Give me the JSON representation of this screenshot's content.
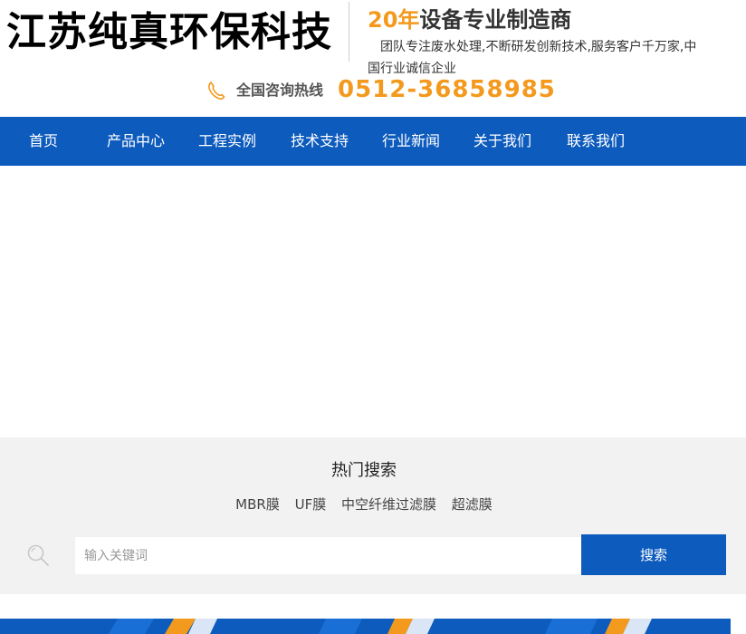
{
  "header": {
    "logo_text": "江苏纯真环保科技",
    "slogan_highlight": "20年",
    "slogan_rest": "设备专业制造商",
    "slogan_desc": "团队专注废水处理,不断研发创新技术,服务客户千万家,中国行业诚信企业",
    "hotline_label": "全国咨询热线",
    "hotline_number": "0512-36858985",
    "icons": {
      "phone": "phone-icon"
    }
  },
  "nav": {
    "items": [
      "首页",
      "产品中心",
      "工程实例",
      "技术支持",
      "行业新闻",
      "关于我们",
      "联系我们"
    ]
  },
  "search": {
    "hot_title": "热门搜索",
    "hot_items": [
      "MBR膜",
      "UF膜",
      "中空纤维过滤膜",
      "超滤膜"
    ],
    "placeholder": "输入关键词",
    "button_label": "搜索",
    "icons": {
      "search": "search-icon"
    }
  },
  "colors": {
    "primary": "#0d5bbd",
    "accent": "#f39a1e",
    "search_bg": "#f2f2f2"
  }
}
